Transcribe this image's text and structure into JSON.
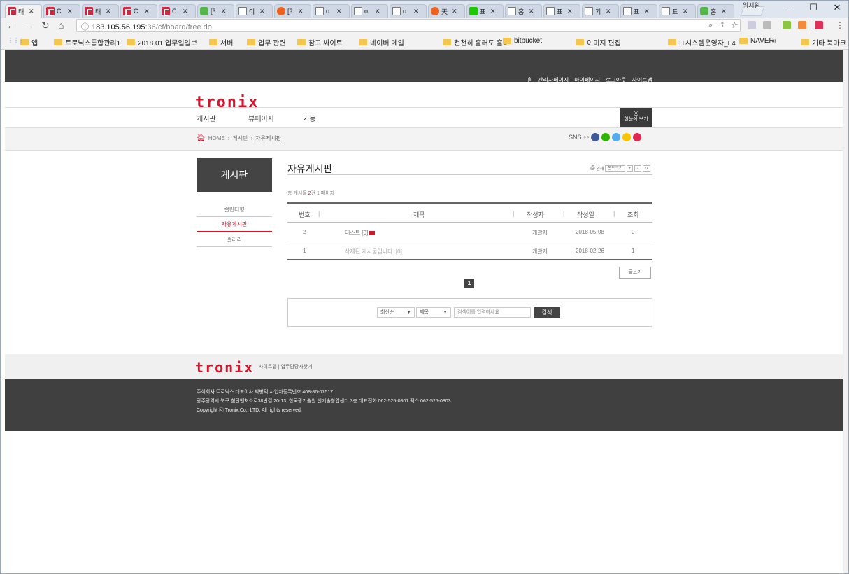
{
  "browser": {
    "tabs": [
      {
        "icon": "tronix",
        "text": "태"
      },
      {
        "icon": "tronix",
        "text": "C"
      },
      {
        "icon": "tronix",
        "text": "태"
      },
      {
        "icon": "tronix",
        "text": "C"
      },
      {
        "icon": "tronix",
        "text": "C"
      },
      {
        "icon": "green",
        "text": "[3"
      },
      {
        "icon": "doc",
        "text": "이"
      },
      {
        "icon": "orange",
        "text": "[?"
      },
      {
        "icon": "doc",
        "text": "o"
      },
      {
        "icon": "doc",
        "text": "o"
      },
      {
        "icon": "doc",
        "text": "o"
      },
      {
        "icon": "orange",
        "text": "天"
      },
      {
        "icon": "naver",
        "text": "표"
      },
      {
        "icon": "doc",
        "text": "홈"
      },
      {
        "icon": "doc",
        "text": "표"
      },
      {
        "icon": "doc",
        "text": "기"
      },
      {
        "icon": "doc",
        "text": "표"
      },
      {
        "icon": "doc",
        "text": "표"
      },
      {
        "icon": "green",
        "text": "홈"
      }
    ],
    "profile": "위지원",
    "url_host": "183.105.56.195",
    "url_path": ":36/cf/board/free.do",
    "bookmarks": [
      "앱",
      "트로닉스통합관리1",
      "2018.01 업무일일보",
      "서버",
      "업무 관련",
      "참고 싸이트",
      "네이버 메일",
      "천천히 흘러도 흘러",
      "bitbucket",
      "이미지 편집",
      "IT시스템운영자_L4",
      "NAVER",
      "기타 북마크"
    ]
  },
  "site": {
    "top_links": [
      "홈",
      "관리자페이지",
      "마이페이지",
      "로그아웃",
      "사이트맵"
    ],
    "logo": "tronix",
    "gnb": [
      "게시판",
      "뷰페이지",
      "기능"
    ],
    "one_view": "한눈에 보기",
    "breadcrumb": [
      "HOME",
      "게시판",
      "자유게시판"
    ],
    "sns_label": "SNS",
    "lnb_title": "게시판",
    "lnb_items": [
      "캘린더형",
      "자유게시판",
      "갤러리"
    ],
    "board_title": "자유게시판",
    "print_label": "인쇄",
    "font_label": "폰트크기",
    "count_prefix": "총 게시물 ",
    "count_num": "2",
    "count_suffix": "건 1 페이지",
    "columns": [
      "번호",
      "제목",
      "작성자",
      "작성일",
      "조회"
    ],
    "rows": [
      {
        "no": "2",
        "title": "테스트 [0]",
        "writer": "개발자",
        "date": "2018-05-08",
        "views": "0"
      },
      {
        "no": "1",
        "title": "삭제된 게시물입니다. [0]",
        "writer": "개발자",
        "date": "2018-02-26",
        "views": "1"
      }
    ],
    "write_btn": "글쓰기",
    "page": "1",
    "sort_select": "최신순",
    "field_select": "제목",
    "search_placeholder": "검색어를 입력하세요",
    "search_btn": "검색",
    "footer_links": [
      "사이트맵",
      "업무담당자찾기"
    ],
    "footer_lines": [
      "주식회사 트로닉스 대표이사 박병덕 사업자등록번호 408-86-07517",
      "광주광역시 북구 첨단벤처소로38번길 20-13, 한국광기술원 신기술창업센터 3층 대표전화 062-525-0801 팩스 062-525-0803",
      "Copyright ⓒ Tronix.Co., LTD. All rights reserved."
    ]
  }
}
